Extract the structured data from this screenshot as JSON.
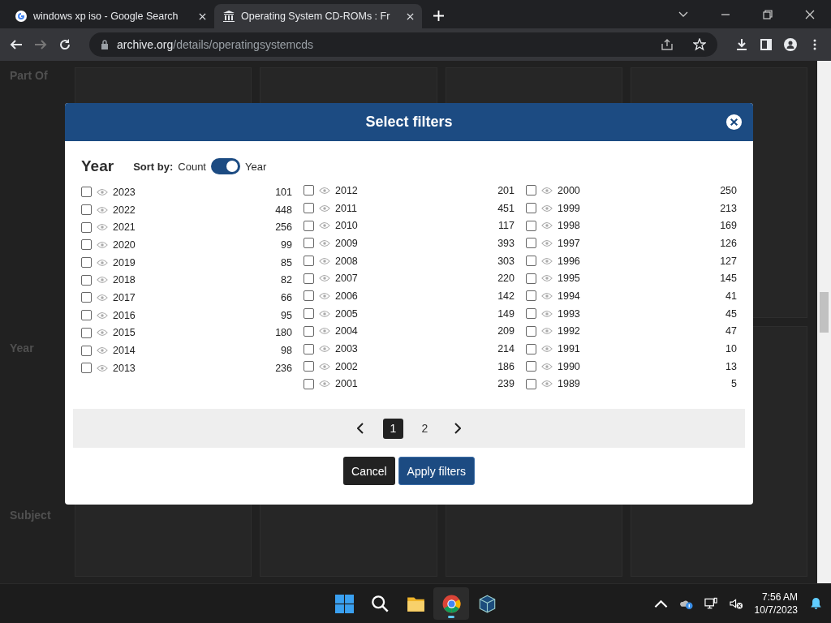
{
  "browser": {
    "tabs": [
      {
        "title": "windows xp iso - Google Search",
        "selected": false
      },
      {
        "title": "Operating System CD-ROMs : Fr",
        "selected": true
      }
    ],
    "address": {
      "domain": "archive.org",
      "path": "/details/operatingsystemcds"
    }
  },
  "background": {
    "headings": [
      "Part Of",
      "Year",
      "Subject"
    ]
  },
  "dialog": {
    "title": "Select filters",
    "facet": "Year",
    "sort": {
      "label": "Sort by:",
      "options": [
        "Count",
        "Year"
      ],
      "by_year": true
    },
    "columns": [
      [
        {
          "year": "2023",
          "count": "101",
          "checked": false
        },
        {
          "year": "2022",
          "count": "448",
          "checked": false
        },
        {
          "year": "2021",
          "count": "256",
          "checked": false
        },
        {
          "year": "2020",
          "count": "99",
          "checked": false
        },
        {
          "year": "2019",
          "count": "85",
          "checked": false
        },
        {
          "year": "2018",
          "count": "82",
          "checked": false
        },
        {
          "year": "2017",
          "count": "66",
          "checked": false
        },
        {
          "year": "2016",
          "count": "95",
          "checked": false
        },
        {
          "year": "2015",
          "count": "180",
          "checked": false
        },
        {
          "year": "2014",
          "count": "98",
          "checked": false
        },
        {
          "year": "2013",
          "count": "236",
          "checked": false
        }
      ],
      [
        {
          "year": "2012",
          "count": "201",
          "checked": false
        },
        {
          "year": "2011",
          "count": "451",
          "checked": false
        },
        {
          "year": "2010",
          "count": "117",
          "checked": false
        },
        {
          "year": "2009",
          "count": "393",
          "checked": false
        },
        {
          "year": "2008",
          "count": "303",
          "checked": false
        },
        {
          "year": "2007",
          "count": "220",
          "checked": false
        },
        {
          "year": "2006",
          "count": "142",
          "checked": false
        },
        {
          "year": "2005",
          "count": "149",
          "checked": false
        },
        {
          "year": "2004",
          "count": "209",
          "checked": false
        },
        {
          "year": "2003",
          "count": "214",
          "checked": false
        },
        {
          "year": "2002",
          "count": "186",
          "checked": false
        },
        {
          "year": "2001",
          "count": "239",
          "checked": false
        }
      ],
      [
        {
          "year": "2000",
          "count": "250",
          "checked": false
        },
        {
          "year": "1999",
          "count": "213",
          "checked": false
        },
        {
          "year": "1998",
          "count": "169",
          "checked": false
        },
        {
          "year": "1997",
          "count": "126",
          "checked": false
        },
        {
          "year": "1996",
          "count": "127",
          "checked": false
        },
        {
          "year": "1995",
          "count": "145",
          "checked": false
        },
        {
          "year": "1994",
          "count": "41",
          "checked": false
        },
        {
          "year": "1993",
          "count": "45",
          "checked": false
        },
        {
          "year": "1992",
          "count": "47",
          "checked": false
        },
        {
          "year": "1991",
          "count": "10",
          "checked": false
        },
        {
          "year": "1990",
          "count": "13",
          "checked": false
        },
        {
          "year": "1989",
          "count": "5",
          "checked": false
        }
      ]
    ],
    "pages": [
      {
        "label": "1",
        "selected": true
      },
      {
        "label": "2",
        "selected": false
      }
    ],
    "buttons": [
      {
        "label": "Cancel",
        "kind": "secondary"
      },
      {
        "label": "Apply filters",
        "kind": "primary"
      }
    ]
  },
  "taskbar": {
    "apps": [
      {
        "kind": "start",
        "active": false
      },
      {
        "kind": "search",
        "active": false
      },
      {
        "kind": "files",
        "active": false
      },
      {
        "kind": "browser",
        "active": true
      },
      {
        "kind": "vm",
        "active": false
      }
    ],
    "time": "7:56 AM",
    "date": "10/7/2023"
  }
}
